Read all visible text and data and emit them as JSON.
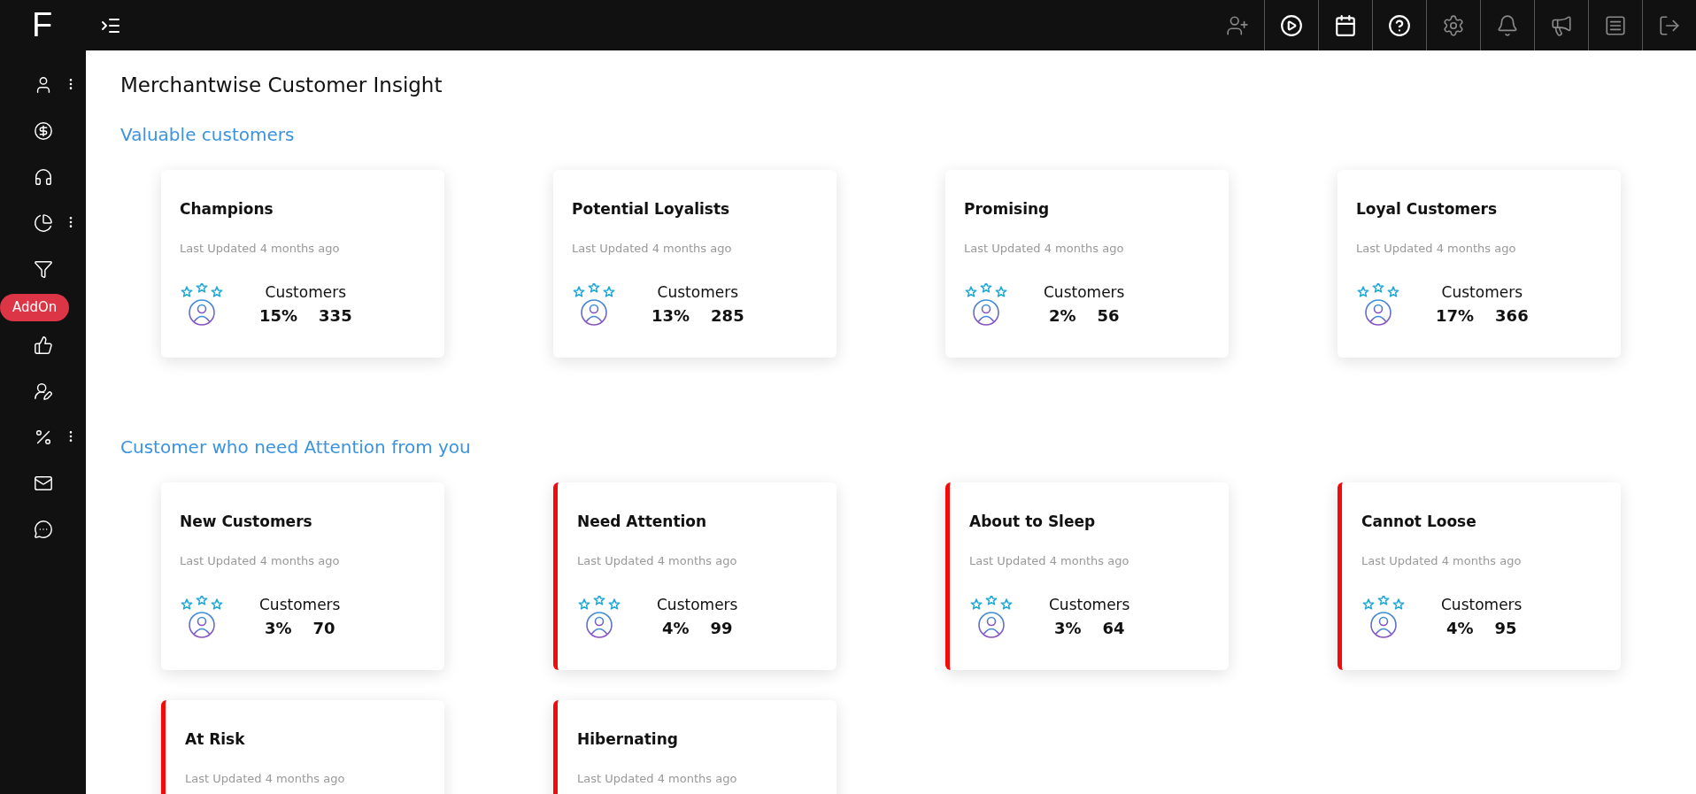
{
  "brand": {
    "logo": "F"
  },
  "sidebar": {
    "items": [
      {
        "kind": "icon",
        "has_menu": true
      },
      {
        "kind": "icon",
        "has_menu": false
      },
      {
        "kind": "icon",
        "has_menu": false
      },
      {
        "kind": "icon",
        "has_menu": true
      },
      {
        "kind": "icon",
        "has_menu": false
      },
      {
        "kind": "badge",
        "label": "AddOn"
      },
      {
        "kind": "icon",
        "has_menu": false
      },
      {
        "kind": "icon",
        "has_menu": false
      },
      {
        "kind": "icon",
        "has_menu": true
      },
      {
        "kind": "icon",
        "has_menu": false
      },
      {
        "kind": "icon",
        "has_menu": false
      }
    ]
  },
  "topbar": {
    "actions": [
      {
        "highlighted": false
      },
      {
        "highlighted": true
      },
      {
        "highlighted": true
      },
      {
        "highlighted": true
      },
      {
        "highlighted": false
      },
      {
        "highlighted": false
      },
      {
        "highlighted": false
      },
      {
        "highlighted": false
      },
      {
        "highlighted": false
      }
    ]
  },
  "page": {
    "title": "Merchantwise Customer Insight"
  },
  "sections": [
    {
      "heading": "Valuable customers",
      "cards": [
        {
          "title": "Champions",
          "updated": "Last Updated 4 months ago",
          "label": "Customers",
          "percent": "15%",
          "count": "335",
          "flagged": false
        },
        {
          "title": "Potential Loyalists",
          "updated": "Last Updated 4 months ago",
          "label": "Customers",
          "percent": "13%",
          "count": "285",
          "flagged": false
        },
        {
          "title": "Promising",
          "updated": "Last Updated 4 months ago",
          "label": "Customers",
          "percent": "2%",
          "count": "56",
          "flagged": false
        },
        {
          "title": "Loyal Customers",
          "updated": "Last Updated 4 months ago",
          "label": "Customers",
          "percent": "17%",
          "count": "366",
          "flagged": false
        }
      ]
    },
    {
      "heading": "Customer who need Attention from you",
      "cards": [
        {
          "title": "New Customers",
          "updated": "Last Updated 4 months ago",
          "label": "Customers",
          "percent": "3%",
          "count": "70",
          "flagged": false
        },
        {
          "title": "Need Attention",
          "updated": "Last Updated 4 months ago",
          "label": "Customers",
          "percent": "4%",
          "count": "99",
          "flagged": true
        },
        {
          "title": "About to Sleep",
          "updated": "Last Updated 4 months ago",
          "label": "Customers",
          "percent": "3%",
          "count": "64",
          "flagged": true
        },
        {
          "title": "Cannot Loose",
          "updated": "Last Updated 4 months ago",
          "label": "Customers",
          "percent": "4%",
          "count": "95",
          "flagged": true
        },
        {
          "title": "At Risk",
          "updated": "Last Updated 4 months ago",
          "flagged": true
        },
        {
          "title": "Hibernating",
          "updated": "Last Updated 4 months ago",
          "flagged": true
        }
      ]
    }
  ]
}
